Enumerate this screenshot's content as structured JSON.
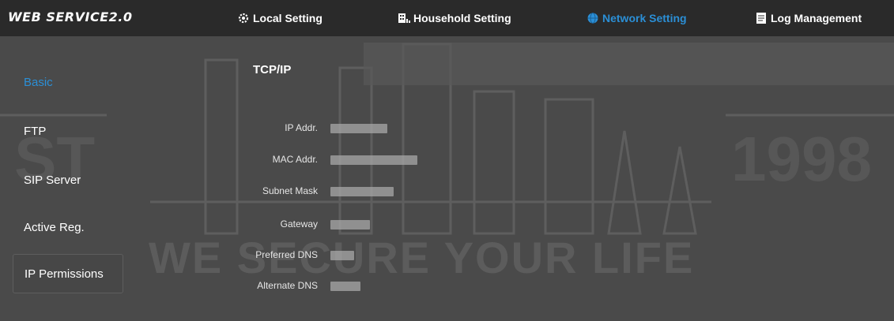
{
  "brand": "WEB SERVICE2.0",
  "nav": {
    "tabs": [
      {
        "label": "Local Setting",
        "icon": "gear-icon"
      },
      {
        "label": "Household Setting",
        "icon": "building-icon"
      },
      {
        "label": "Network Setting",
        "icon": "globe-icon",
        "active": true
      },
      {
        "label": "Log Management",
        "icon": "document-icon"
      }
    ]
  },
  "sidebar": {
    "items": [
      {
        "label": "Basic",
        "active": true
      },
      {
        "label": "FTP"
      },
      {
        "label": "SIP Server"
      },
      {
        "label": "Active Reg."
      },
      {
        "label": "IP Permissions"
      }
    ]
  },
  "content": {
    "section_title": "TCP/IP",
    "fields": [
      {
        "label": "IP Addr."
      },
      {
        "label": "MAC Addr."
      },
      {
        "label": "Subnet Mask"
      },
      {
        "label": "Gateway"
      },
      {
        "label": "Preferred DNS"
      },
      {
        "label": "Alternate DNS"
      }
    ]
  },
  "watermark": {
    "slogan": "WE SECURE YOUR LIFE",
    "year": "1998",
    "left_text": "ST"
  },
  "colors": {
    "topbar": "#2a2a2a",
    "background": "#4a4a4a",
    "accent": "#2b8fd6",
    "text": "#ffffff"
  }
}
